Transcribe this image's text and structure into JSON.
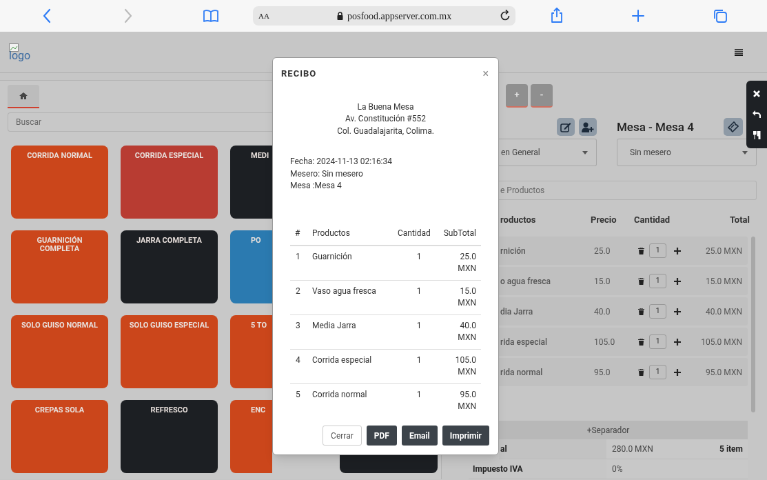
{
  "browser": {
    "back_disabled": false,
    "forward_disabled": true,
    "text_size": "AA",
    "url": "posfood.appserver.com.mx"
  },
  "header": {
    "logo_alt": "logo"
  },
  "left": {
    "home_tab": {
      "selected": true
    },
    "search": {
      "placeholder": "Buscar"
    },
    "tile_rows": [
      [
        {
          "label": "CORRIDA NORMAL",
          "color": "#cb461b"
        },
        {
          "label": "CORRIDA ESPECIAL",
          "color": "#b83c32"
        },
        {
          "label": "MEDI",
          "color": "#1c1f23"
        }
      ],
      [
        {
          "label": "GUARNICIÓN COMPLETA",
          "color": "#cb461b"
        },
        {
          "label": "JARRA COMPLETA",
          "color": "#1c1f23"
        },
        {
          "label": "PO",
          "color": "#2b7ab0"
        }
      ],
      [
        {
          "label": "SOLO GUISO NORMAL",
          "color": "#cb461b"
        },
        {
          "label": "SOLO GUISO ESPECIAL",
          "color": "#cb461b"
        },
        {
          "label": "5 TO",
          "color": "#cb461b"
        }
      ],
      [
        {
          "label": "CREPAS SOLA",
          "color": "#cb461b"
        },
        {
          "label": "REFRESCO",
          "color": "#1c1f23"
        },
        {
          "label": "ENC",
          "color": "#cb461b"
        },
        {
          "color": "#1c1f23"
        }
      ]
    ]
  },
  "right": {
    "top_buttons": [
      "+",
      "-"
    ],
    "table_title": "Mesa - Mesa 4",
    "customer_select": "en General",
    "waiter_select": "Sin mesero",
    "search": {
      "placeholder": "e Productos"
    },
    "columns": [
      "roductos",
      "Precio",
      "Cantidad",
      "Total"
    ],
    "items": [
      {
        "name": "rnición",
        "price": "25.0",
        "qty": "1",
        "total": "25.0 MXN"
      },
      {
        "name": "o agua fresca",
        "price": "15.0",
        "qty": "1",
        "total": "15.0 MXN"
      },
      {
        "name": "dia Jarra",
        "price": "40.0",
        "qty": "1",
        "total": "40.0 MXN"
      },
      {
        "name": "rida especial",
        "price": "105.0",
        "qty": "1",
        "total": "105.0 MXN"
      },
      {
        "name": "rida normal",
        "price": "95.0",
        "qty": "1",
        "total": "95.0 MXN"
      }
    ],
    "separator": "+Separador",
    "summary": [
      {
        "label": "al",
        "value": "280.0 MXN",
        "count": "5 item"
      },
      {
        "label": "Impuesto IVA",
        "value": "0%"
      }
    ]
  },
  "modal": {
    "title": "RECIBO",
    "close": "×",
    "business": [
      "La Buena Mesa",
      "Av. Constitución #552",
      "Col. Guadalajarita, Colima."
    ],
    "info": [
      "Fecha: 2024-11-13 02:16:34",
      "Mesero: Sin mesero",
      "Mesa :Mesa 4"
    ],
    "columns": [
      "#",
      "Productos",
      "Cantidad",
      "SubTotal"
    ],
    "rows": [
      {
        "n": "1",
        "product": "Guarnición",
        "qty": "1",
        "subtotal": "25.0 MXN"
      },
      {
        "n": "2",
        "product": "Vaso agua fresca",
        "qty": "1",
        "subtotal": "15.0 MXN"
      },
      {
        "n": "3",
        "product": "Media Jarra",
        "qty": "1",
        "subtotal": "40.0 MXN"
      },
      {
        "n": "4",
        "product": "Corrida especial",
        "qty": "1",
        "subtotal": "105.0 MXN"
      },
      {
        "n": "5",
        "product": "Corrida normal",
        "qty": "1",
        "subtotal": "95.0 MXN"
      }
    ],
    "buttons": [
      {
        "label": "Cerrar",
        "kind": "secondary"
      },
      {
        "label": "PDF",
        "kind": "primary"
      },
      {
        "label": "Email",
        "kind": "primary"
      },
      {
        "label": "Imprimir",
        "kind": "primary"
      }
    ]
  }
}
